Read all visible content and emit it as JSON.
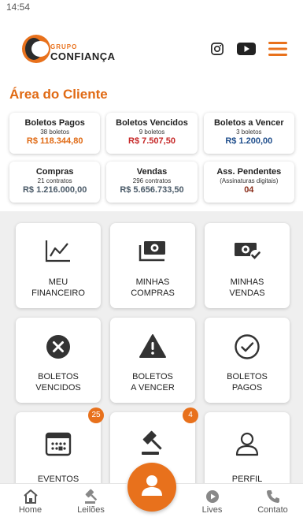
{
  "status_bar": {
    "time": "14:54"
  },
  "header": {
    "logo": {
      "top": "GRUPO",
      "main": "CONFIANÇA"
    },
    "icons": [
      "instagram-icon",
      "youtube-icon",
      "menu-icon"
    ],
    "accent": "#e8711c"
  },
  "page_title": "Área do Cliente",
  "summary_row1": [
    {
      "title": "Boletos Pagos",
      "sub": "38 boletos",
      "value": "R$ 118.344,80",
      "color": "#e06a14"
    },
    {
      "title": "Boletos Vencidos",
      "sub": "9 boletos",
      "value": "R$ 7.507,50",
      "color": "#c62828"
    },
    {
      "title": "Boletos a Vencer",
      "sub": "3 boletos",
      "value": "R$ 1.200,00",
      "color": "#1f4e8c"
    }
  ],
  "summary_row2": [
    {
      "title": "Compras",
      "sub": "21 contratos",
      "value": "R$ 1.216.000,00",
      "color": "#4a5a68"
    },
    {
      "title": "Vendas",
      "sub": "296 contratos",
      "value": "R$ 5.656.733,50",
      "color": "#4a5a68"
    },
    {
      "title": "Ass. Pendentes",
      "sub": "(Assinaturas digitais)",
      "value": "04",
      "color": "#8a2d1a"
    }
  ],
  "tiles": [
    {
      "label1": "MEU",
      "label2": "FINANCEIRO",
      "icon": "chart-line-icon"
    },
    {
      "label1": "MINHAS",
      "label2": "COMPRAS",
      "icon": "money-icon"
    },
    {
      "label1": "MINHAS",
      "label2": "VENDAS",
      "icon": "money-check-icon"
    },
    {
      "label1": "BOLETOS",
      "label2": "VENCIDOS",
      "icon": "cancel-circle-icon"
    },
    {
      "label1": "BOLETOS",
      "label2": "A VENCER",
      "icon": "warning-icon"
    },
    {
      "label1": "BOLETOS",
      "label2": "PAGOS",
      "icon": "check-circle-icon"
    },
    {
      "label1": "EVENTOS",
      "label2": "",
      "icon": "calendar-icon",
      "badge": "25"
    },
    {
      "label1": "",
      "label2": "",
      "icon": "gavel-icon",
      "badge": "4"
    },
    {
      "label1": "PERFIL",
      "label2": "",
      "icon": "user-icon"
    }
  ],
  "bottom_nav": [
    {
      "label": "Home",
      "icon": "home-icon"
    },
    {
      "label": "Leilões",
      "icon": "gavel-icon"
    },
    {
      "label": "",
      "icon": "user-icon"
    },
    {
      "label": "Lives",
      "icon": "play-circle-icon"
    },
    {
      "label": "Contato",
      "icon": "phone-icon"
    }
  ]
}
